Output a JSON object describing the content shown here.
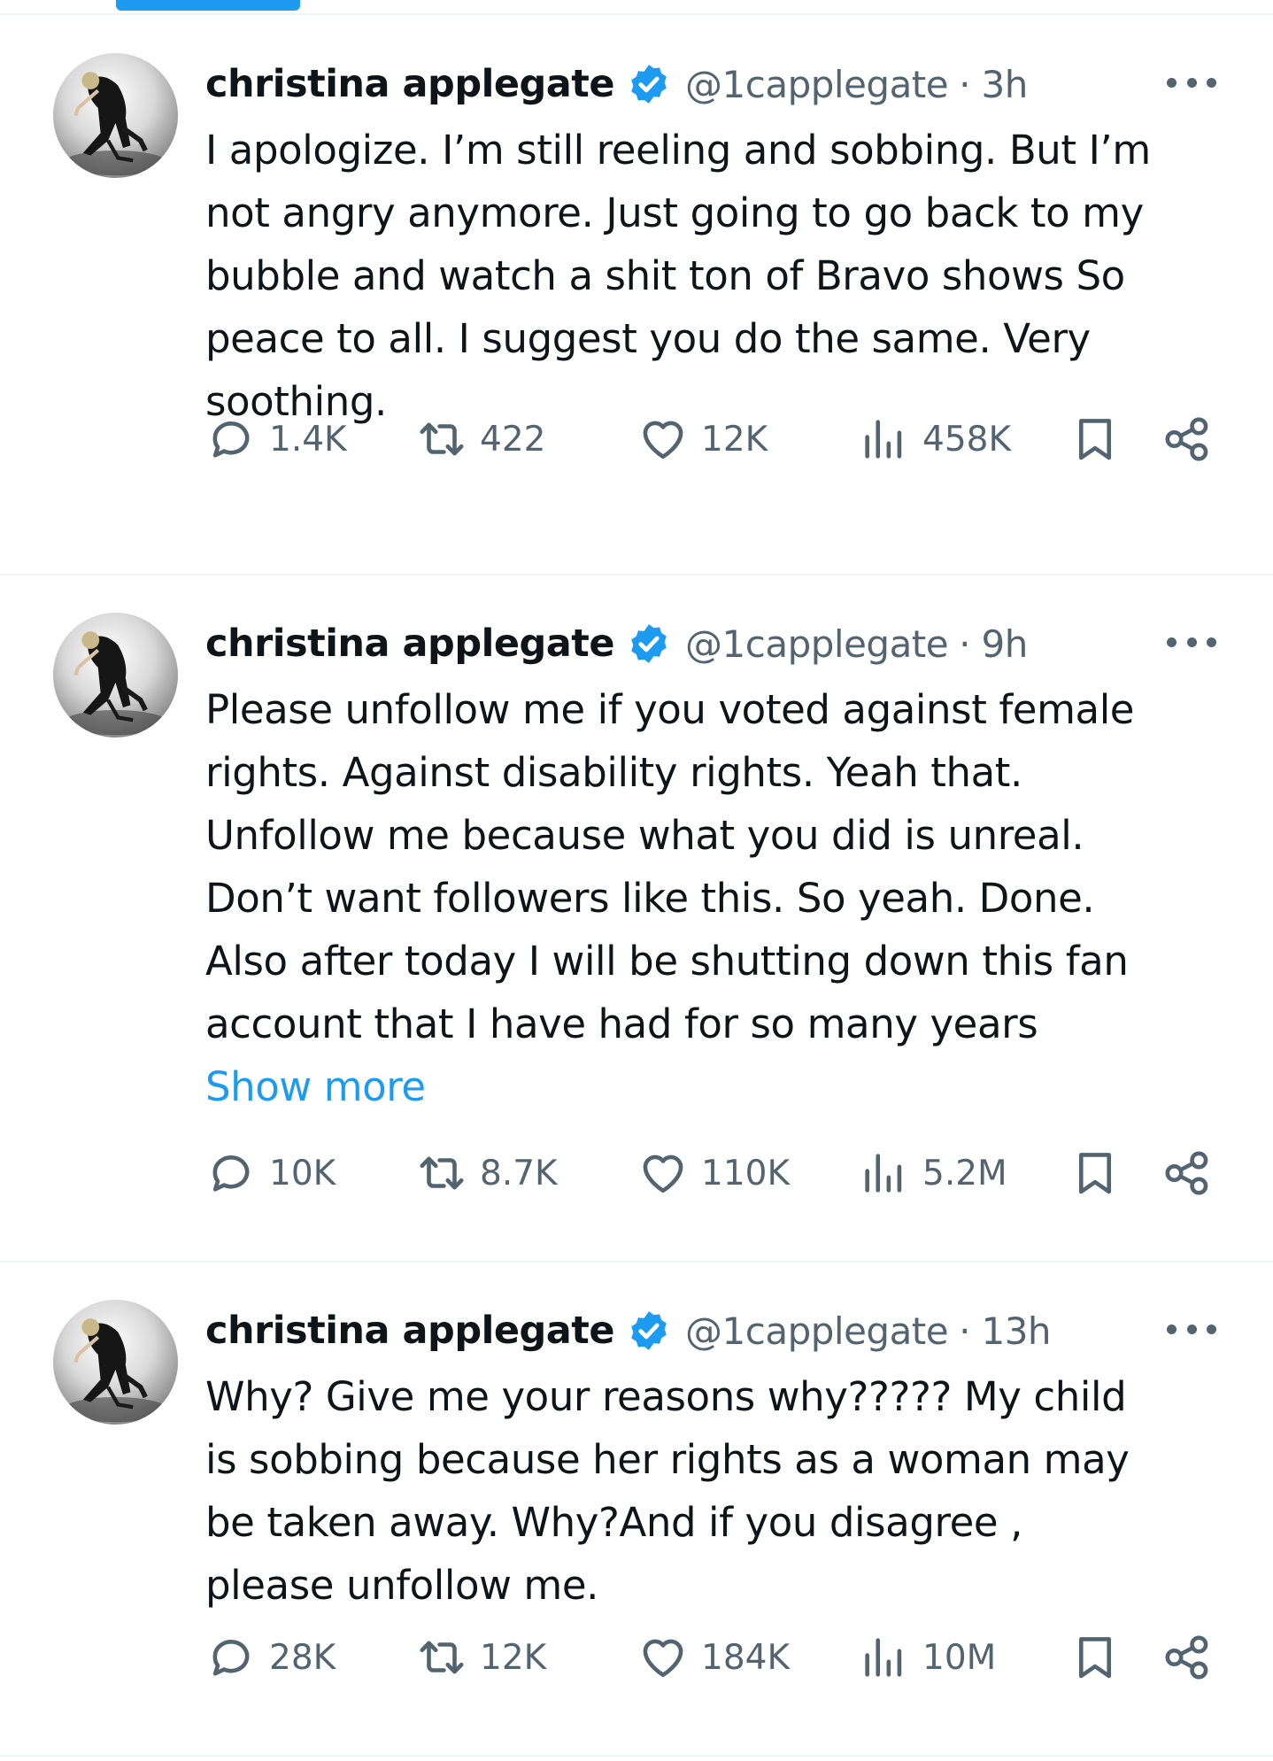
{
  "tweets": [
    {
      "author": "christina applegate",
      "handle": "@1capplegate",
      "separator": "·",
      "time": "3h",
      "text_lines": [
        "I apologize. I’m still reeling and sobbing. But I’m",
        "not angry anymore. Just going to go back to my",
        "bubble and watch a shit ton of Bravo shows   So",
        "peace to all. I suggest you do the same. Very",
        "soothing."
      ],
      "show_more": "",
      "replies": "1.4K",
      "reposts": "422",
      "likes": "12K",
      "views": "458K"
    },
    {
      "author": "christina applegate",
      "handle": "@1capplegate",
      "separator": "·",
      "time": "9h",
      "text_lines": [
        "Please unfollow me if you voted against female",
        "rights. Against disability rights. Yeah that.",
        "Unfollow me because what you did is unreal.",
        "Don’t want followers like this. So yeah. Done.",
        "Also after today I will be shutting down this fan",
        "account that I have had for so many years"
      ],
      "show_more": "Show more",
      "replies": "10K",
      "reposts": "8.7K",
      "likes": "110K",
      "views": "5.2M"
    },
    {
      "author": "christina applegate",
      "handle": "@1capplegate",
      "separator": "·",
      "time": "13h",
      "text_lines": [
        "Why? Give me your reasons why????? My child",
        "is sobbing because her rights as a woman may",
        "be taken away. Why?And if you disagree ,",
        "please unfollow me."
      ],
      "show_more": "",
      "replies": "28K",
      "reposts": "12K",
      "likes": "184K",
      "views": "10M"
    }
  ],
  "icons": {
    "verified": "verified-badge-icon",
    "more": "more-options-icon",
    "reply": "reply-icon",
    "repost": "repost-icon",
    "like": "heart-icon",
    "views": "views-chart-icon",
    "bookmark": "bookmark-icon",
    "share": "share-icon"
  },
  "colors": {
    "accent": "#1d9bf0",
    "text": "#0f1419",
    "secondary": "#536471",
    "divider": "#eff3f4"
  }
}
